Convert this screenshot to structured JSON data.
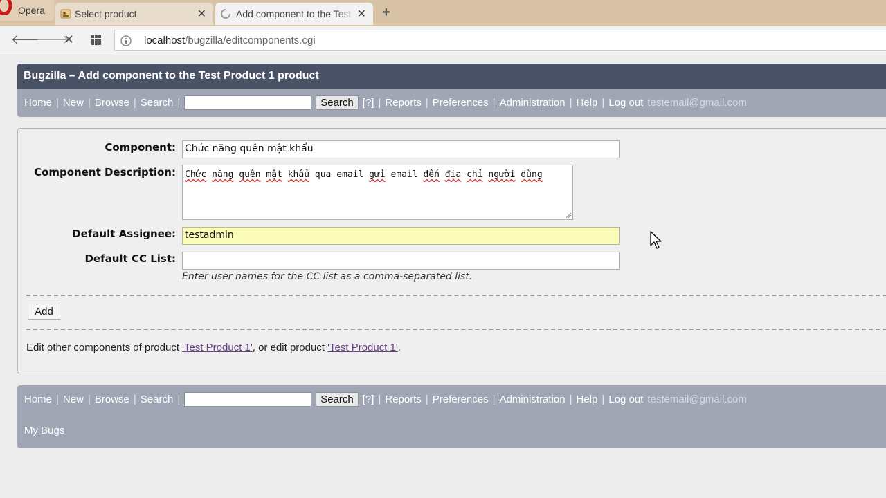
{
  "browser": {
    "menu_label": "Opera",
    "tabs": [
      {
        "title": "Select product"
      },
      {
        "title": "Add component to the Test"
      }
    ],
    "new_tab_label": "+",
    "url_host": "localhost",
    "url_path": "/bugzilla/editcomponents.cgi"
  },
  "page": {
    "header_title": "Bugzilla – Add component to the Test Product 1 product"
  },
  "nav": {
    "home": "Home",
    "new": "New",
    "browse": "Browse",
    "search": "Search",
    "search_button": "Search",
    "help_q": "[?]",
    "reports": "Reports",
    "preferences": "Preferences",
    "administration": "Administration",
    "help": "Help",
    "logout": "Log out",
    "user_email": "testemail@gmail.com",
    "my_bugs": "My Bugs",
    "separator": "|"
  },
  "form": {
    "component_label": "Component:",
    "component_value": "Chức năng quên mật khẩu",
    "description_label": "Component Description:",
    "description_words": [
      "Chức",
      "năng",
      "quên",
      "mật",
      "khẩu",
      "qua",
      "email",
      "gửi",
      "email",
      "đến",
      "địa",
      "chỉ",
      "người",
      "dùng"
    ],
    "assignee_label": "Default Assignee:",
    "assignee_value": "testadmin",
    "cc_label": "Default CC List:",
    "cc_value": "",
    "cc_hint": "Enter user names for the CC list as a comma-separated list.",
    "add_button": "Add"
  },
  "footer_text": {
    "prefix": "Edit other components of product ",
    "product_link_1": "'Test Product 1'",
    "middle": ", or edit product ",
    "product_link_2": "'Test Product 1'",
    "suffix": "."
  },
  "colors": {
    "header_bg": "#4a5266",
    "nav_bg": "#a1a6b5",
    "assignee_highlight": "#fafcb8",
    "link_visited": "#6b3f8c"
  }
}
